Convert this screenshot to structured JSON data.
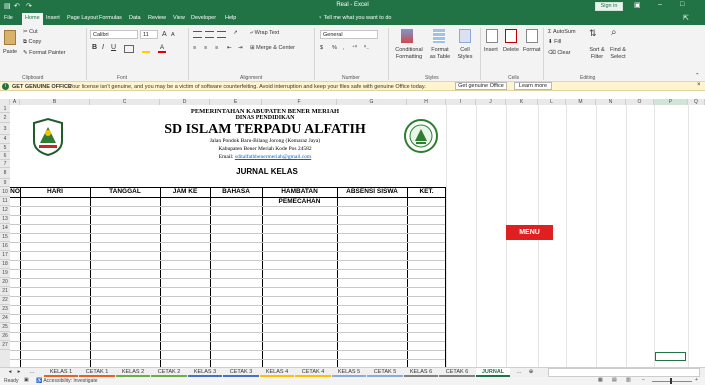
{
  "titlebar": {
    "undo": "↶",
    "redo": "↷",
    "title": "Real - Excel",
    "signin": "Sign in",
    "restore": "▣",
    "minimize": "–",
    "maximize": "□"
  },
  "tabs": [
    "File",
    "Home",
    "Insert",
    "Page Layout",
    "Formulas",
    "Data",
    "Review",
    "View",
    "Developer",
    "Help"
  ],
  "tellme": "Tell me what you want to do",
  "share": "⇱",
  "ribbon": {
    "paste": "Paste",
    "cut": "Cut",
    "copy": "Copy",
    "format_painter": "Format Painter",
    "clipboard": "Clipboard",
    "font_name": "Calibri",
    "font_size": "11",
    "font_grow": "A",
    "font_shrink": "A",
    "bold": "B",
    "italic": "I",
    "underline": "U",
    "font_group": "Font",
    "wrap_text": "Wrap Text",
    "merge_center": "Merge & Center",
    "alignment_group": "Alignment",
    "number_format": "General",
    "percent": "%",
    "comma": ",",
    "number_group": "Number",
    "conditional_formatting": "Conditional Formatting",
    "format_as_table": "Format as Table",
    "cell_styles": "Cell Styles",
    "styles_group": "Styles",
    "insert": "Insert",
    "delete": "Delete",
    "format": "Format",
    "cells_group": "Cells",
    "autosum": "AutoSum",
    "fill": "Fill",
    "clear": "Clear",
    "sort_filter": "Sort & Filter",
    "find_select": "Find & Select",
    "editing_group": "Editing"
  },
  "message": {
    "title": "GET GENUINE OFFICE",
    "text": "Your license isn't genuine, and you may be a victim of software counterfeiting. Avoid interruption and keep your files safe with genuine Office today.",
    "btn1": "Get genuine Office",
    "btn2": "Learn more",
    "close": "×"
  },
  "columns": [
    "A",
    "B",
    "C",
    "D",
    "E",
    "F",
    "G",
    "H",
    "I",
    "J",
    "K",
    "L",
    "M",
    "N",
    "O",
    "P",
    "Q"
  ],
  "rows": [
    "1",
    "2",
    "3",
    "4",
    "5",
    "6",
    "7",
    "8",
    "9",
    "10",
    "11",
    "12",
    "13",
    "14",
    "15",
    "16",
    "17",
    "18",
    "19",
    "20",
    "21",
    "22",
    "23",
    "24",
    "25",
    "26",
    "27"
  ],
  "header": {
    "line1": "PEMERINTAHAN KABUPATEN BENER MERIAH",
    "line2": "DINAS PENDIDIKAN",
    "school": "SD ISLAM TERPADU ALFATIH",
    "addr1": "Jalan Pondok Baru-Bilang Jorong (Kemaraz Jaya)",
    "addr2": "Kabupaten Bener Meriah Kode Pos 24582",
    "email_label": "Email:",
    "email": "sditalfathbenermeriah@gmail.com"
  },
  "jurnal_title": "JURNAL KELAS",
  "table_headers": [
    "NO",
    "HARI",
    "TANGGAL",
    "JAM KE",
    "BAHASA",
    "HAMBATAN PEMECAHAN",
    "ABSENSI SISWA",
    "KET."
  ],
  "menu_button": "MENU",
  "sheet_tabs": [
    {
      "label": "KELAS 1",
      "color": "#e8611f"
    },
    {
      "label": "CETAK 1",
      "color": "#e8611f"
    },
    {
      "label": "KELAS 2",
      "color": "#70ad47"
    },
    {
      "label": "CETAK 2",
      "color": "#70ad47"
    },
    {
      "label": "KELAS 3",
      "color": "#4472c4"
    },
    {
      "label": "CETAK 3",
      "color": "#4472c4"
    },
    {
      "label": "KELAS 4",
      "color": "#ffc000"
    },
    {
      "label": "CETAK 4",
      "color": "#ffc000"
    },
    {
      "label": "KELAS 5",
      "color": "#8ea9db"
    },
    {
      "label": "CETAK 5",
      "color": "#8ea9db"
    },
    {
      "label": "KELAS 6",
      "color": "#808080"
    },
    {
      "label": "CETAK 6",
      "color": "#808080"
    },
    {
      "label": "JURNAL",
      "color": "#ffffff"
    }
  ],
  "status": {
    "ready": "Ready",
    "accessibility": "Accessibility: Investigate",
    "zoom_minus": "–",
    "zoom_plus": "+",
    "zoom": "100"
  },
  "colors": {
    "excel_green": "#217346",
    "menu_red": "#e02020",
    "message_bar": "#fff4ce"
  }
}
